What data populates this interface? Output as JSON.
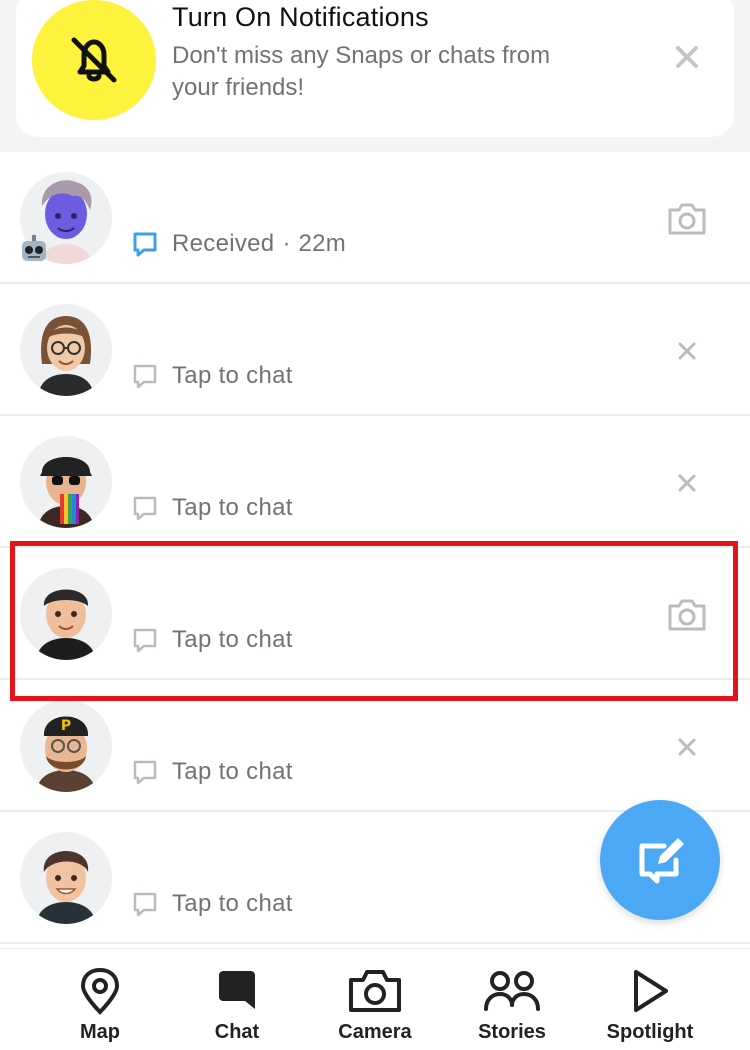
{
  "notification": {
    "title": "Turn On Notifications",
    "text": "Don't miss any Snaps or chats from your friends!",
    "icon": "bell-off-icon",
    "close_icon": "close-icon",
    "accent": "#fdf23c"
  },
  "chats": [
    {
      "status": "Received",
      "time": "22m",
      "action": "camera-icon",
      "status_icon": "received-chat-icon"
    },
    {
      "status": "Tap to chat",
      "action": "close-icon",
      "status_icon": "chat-bubble-icon"
    },
    {
      "status": "Tap to chat",
      "action": "close-icon",
      "status_icon": "chat-bubble-icon"
    },
    {
      "status": "Tap to chat",
      "action": "camera-icon",
      "status_icon": "chat-bubble-icon"
    },
    {
      "status": "Tap to chat",
      "action": "close-icon",
      "status_icon": "chat-bubble-icon"
    },
    {
      "status": "Tap to chat",
      "action": "none",
      "status_icon": "chat-bubble-icon"
    }
  ],
  "highlight_color": "#e3141b",
  "fab": {
    "icon": "compose-chat-icon",
    "color": "#4aa8f5"
  },
  "nav": {
    "items": [
      {
        "label": "Map",
        "icon": "map-pin-icon"
      },
      {
        "label": "Chat",
        "icon": "chat-icon"
      },
      {
        "label": "Camera",
        "icon": "camera-icon"
      },
      {
        "label": "Stories",
        "icon": "stories-icon"
      },
      {
        "label": "Spotlight",
        "icon": "spotlight-icon"
      }
    ]
  }
}
